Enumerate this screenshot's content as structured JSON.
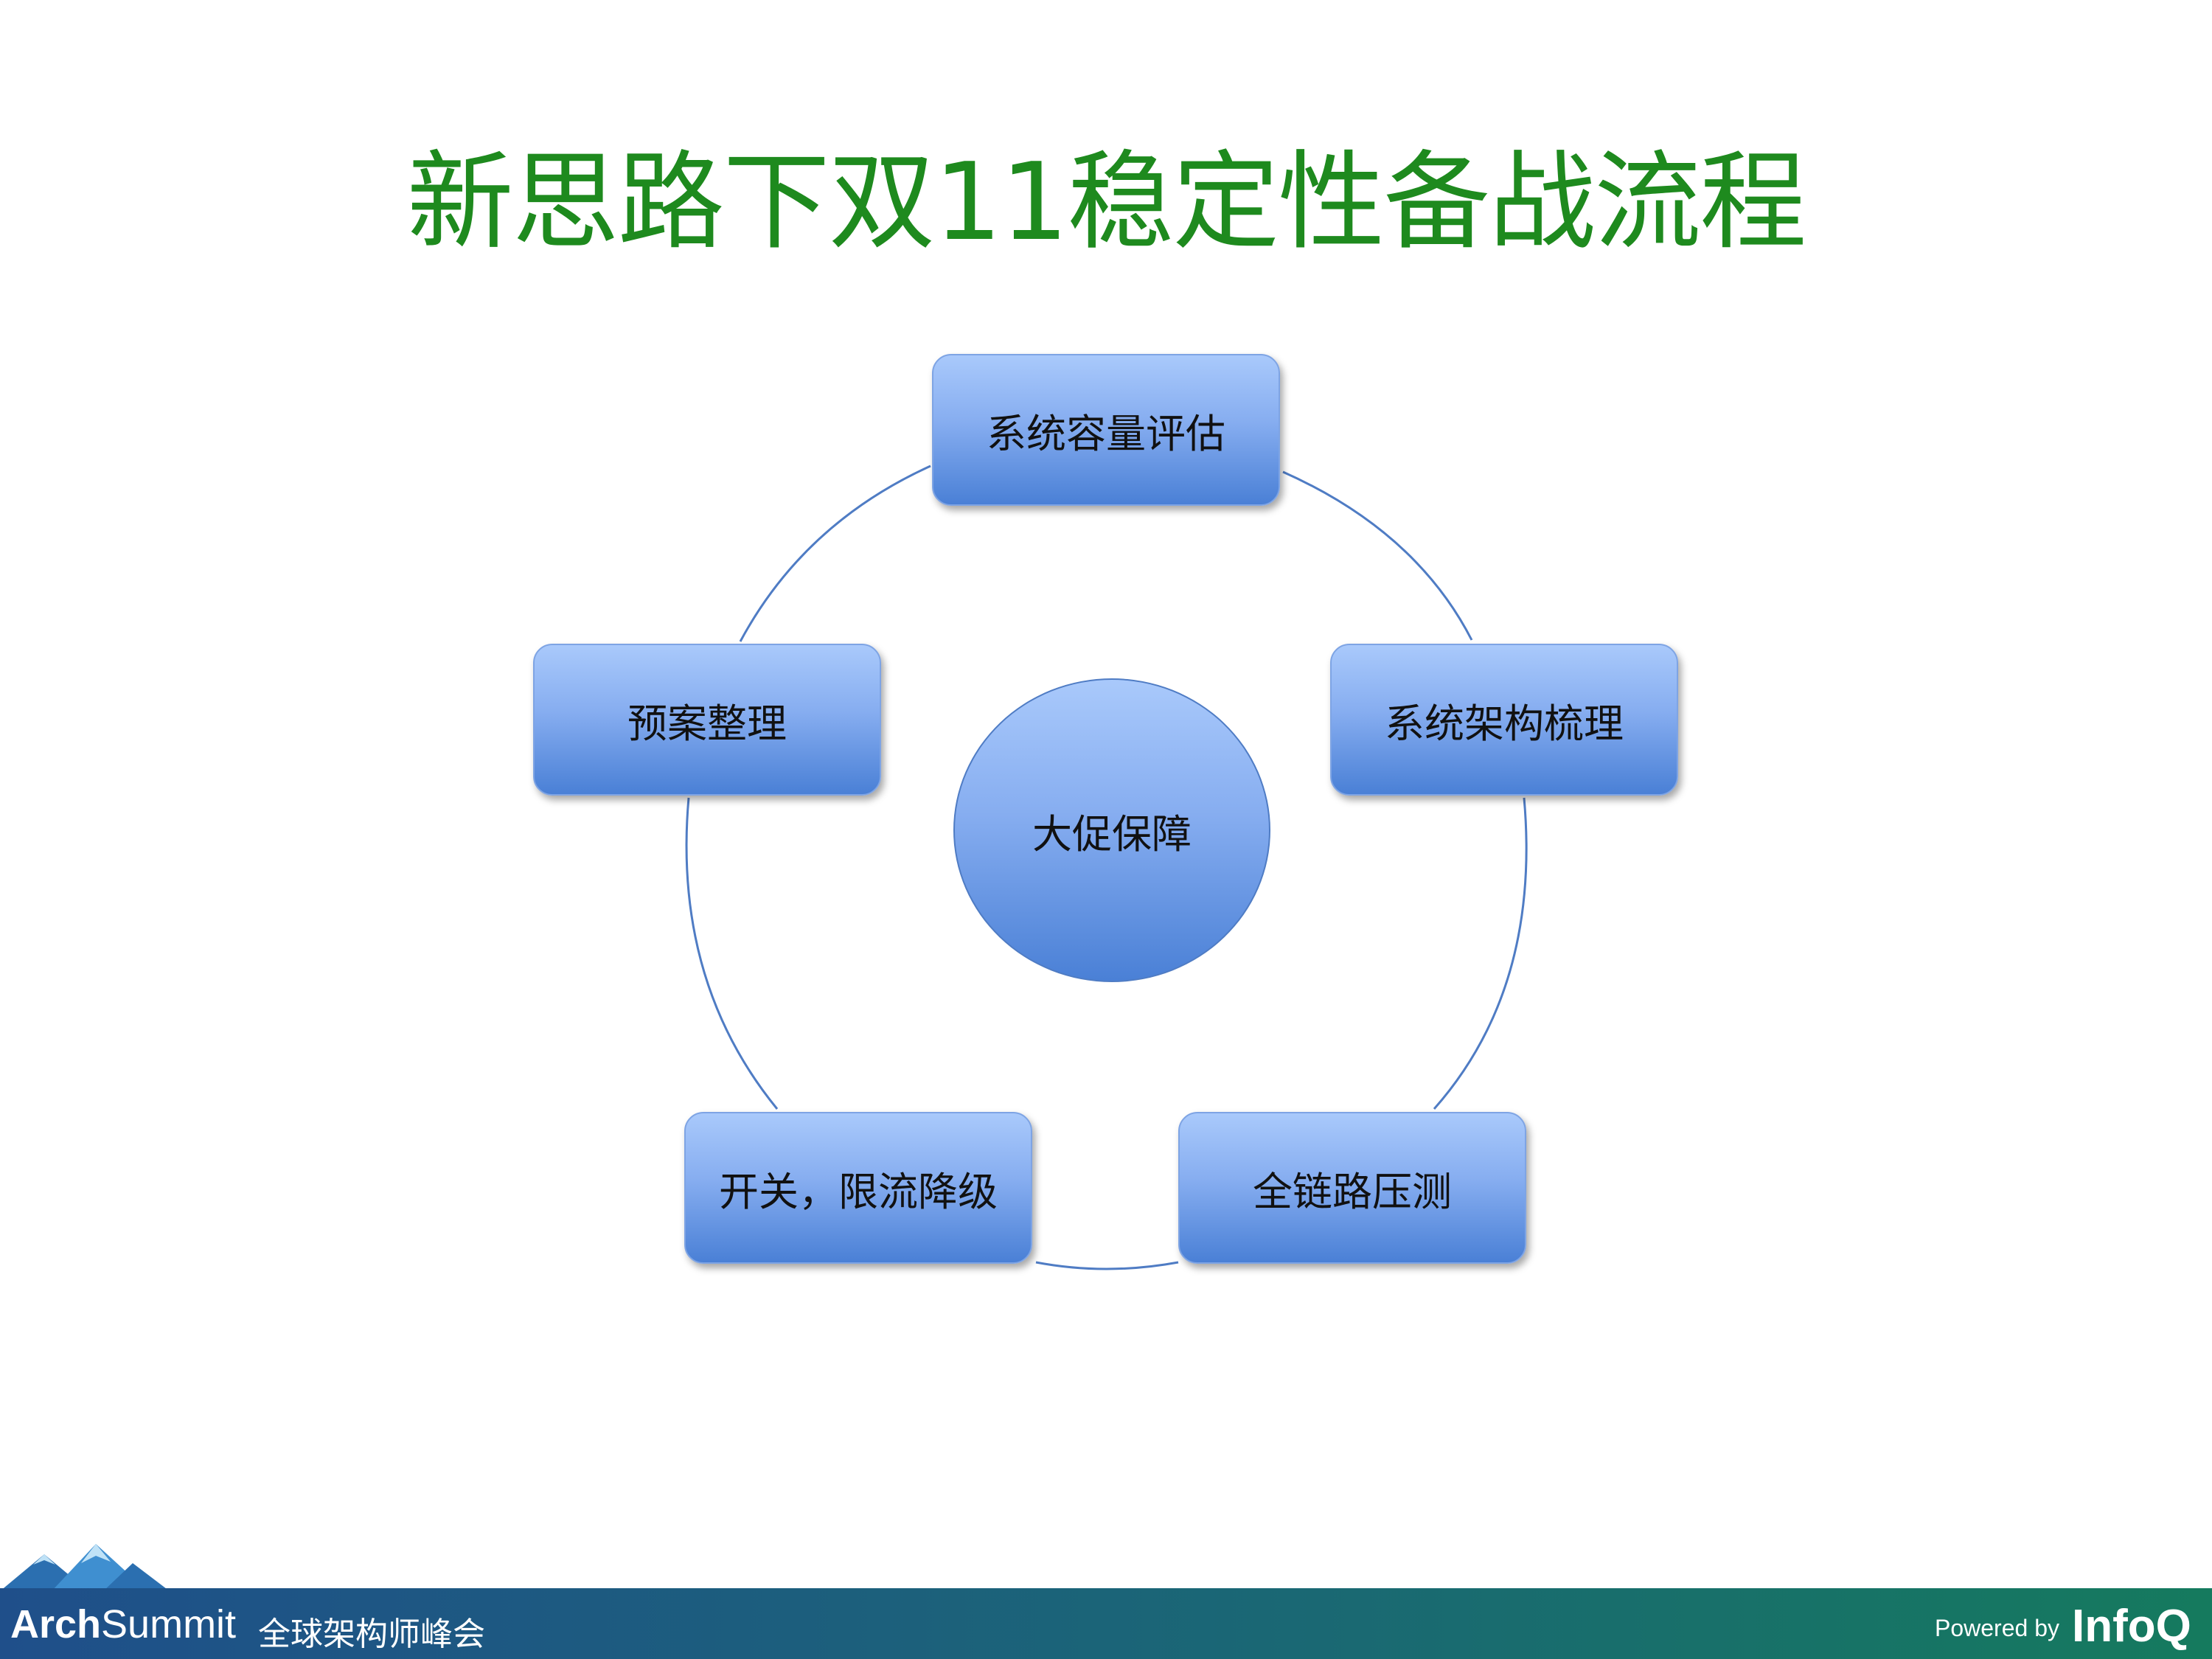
{
  "slide": {
    "title": "新思路下双11稳定性备战流程"
  },
  "diagram": {
    "center_label": "大促保障",
    "nodes": [
      {
        "label": "系统容量评估"
      },
      {
        "label": "系统架构梳理"
      },
      {
        "label": "全链路压测"
      },
      {
        "label": "开关，限流降级"
      },
      {
        "label": "预案整理"
      }
    ]
  },
  "footer": {
    "brand_bold": "Arch",
    "brand_rest": "Summit",
    "subtitle": "全球架构师峰会",
    "powered_by": "Powered by",
    "sponsor": "InfoQ"
  },
  "colors": {
    "title": "#1e8a1e",
    "node_top": "#a9c9fb",
    "node_bottom": "#4a80d6",
    "connector": "#4f7cc4",
    "footer_left": "#1f4f8a",
    "footer_right": "#157a5e"
  }
}
